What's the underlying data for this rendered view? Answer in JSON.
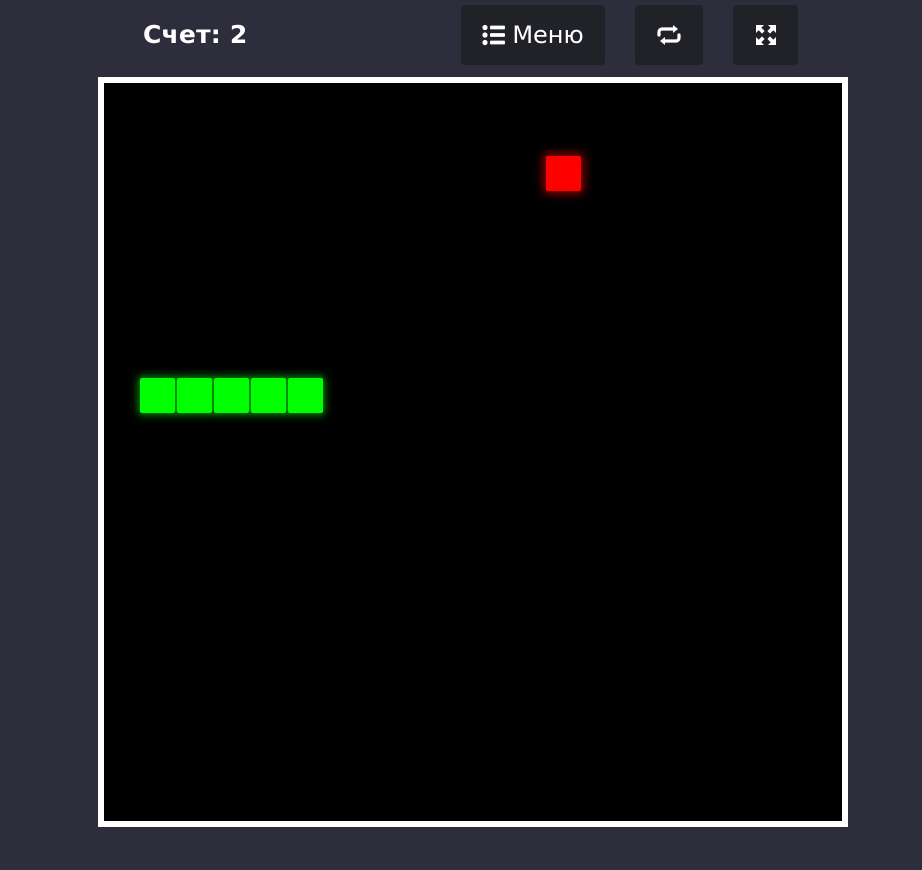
{
  "score": {
    "text": "Счет: 2"
  },
  "toolbar": {
    "menu_label": "Меню",
    "menu_icon": "list-icon",
    "restart_icon": "repeat-icon",
    "fullscreen_icon": "expand-icon"
  },
  "game": {
    "board_color": "#000000",
    "border_color": "#ffffff",
    "snake_color": "#00ff00",
    "food_color": "#ff0000",
    "snake_length": 5,
    "snake_direction": "right"
  },
  "colors": {
    "page_background": "#2e2d3b",
    "button_background": "#202228",
    "text": "#ffffff"
  }
}
